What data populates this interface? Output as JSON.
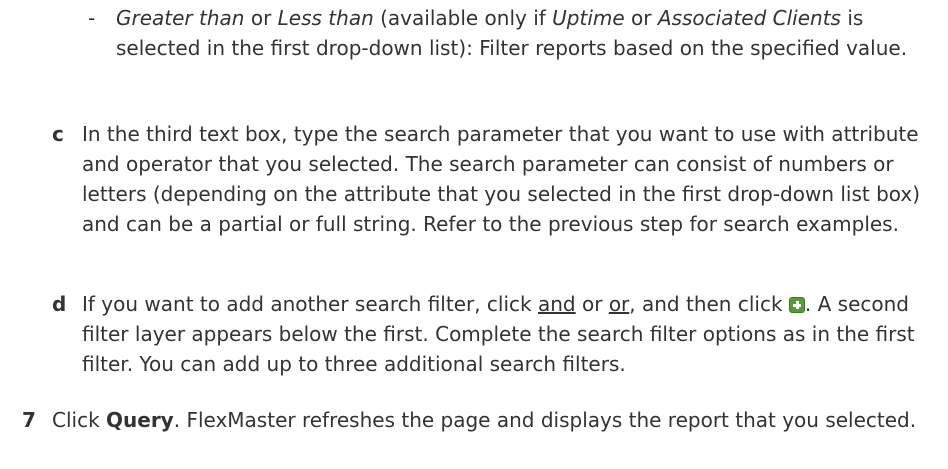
{
  "bullet": {
    "marker": "-",
    "term1": "Greater than",
    "or1": " or ",
    "term2": "Less than",
    "mid1": " (available only if ",
    "term3": "Uptime",
    "or2": " or ",
    "term4": "Associated Clients",
    "rest": " is selected in the first drop-down list): Filter reports based on the specified value."
  },
  "step_c": {
    "letter": "c",
    "text": "In the third text box, type the search parameter that you want to use with attribute and operator that you selected. The search parameter can consist of numbers or letters (depending on the attribute that you selected in the first drop-down list box) and can be a partial or full string. Refer to the previous step for search examples."
  },
  "step_d": {
    "letter": "d",
    "before": "If you want to add another search filter, click ",
    "and": "and",
    "or_text": " or ",
    "or_link": "or",
    "middle": ", and then click ",
    "icon": "add-filter-icon",
    "after": ". A second filter layer appears below the first. Complete the search filter options as in the first filter. You can add up to three additional search filters."
  },
  "step_7": {
    "number": "7",
    "lead": "Click ",
    "bold": "Query",
    "rest": ". FlexMaster refreshes the page and displays the report that you selected."
  }
}
